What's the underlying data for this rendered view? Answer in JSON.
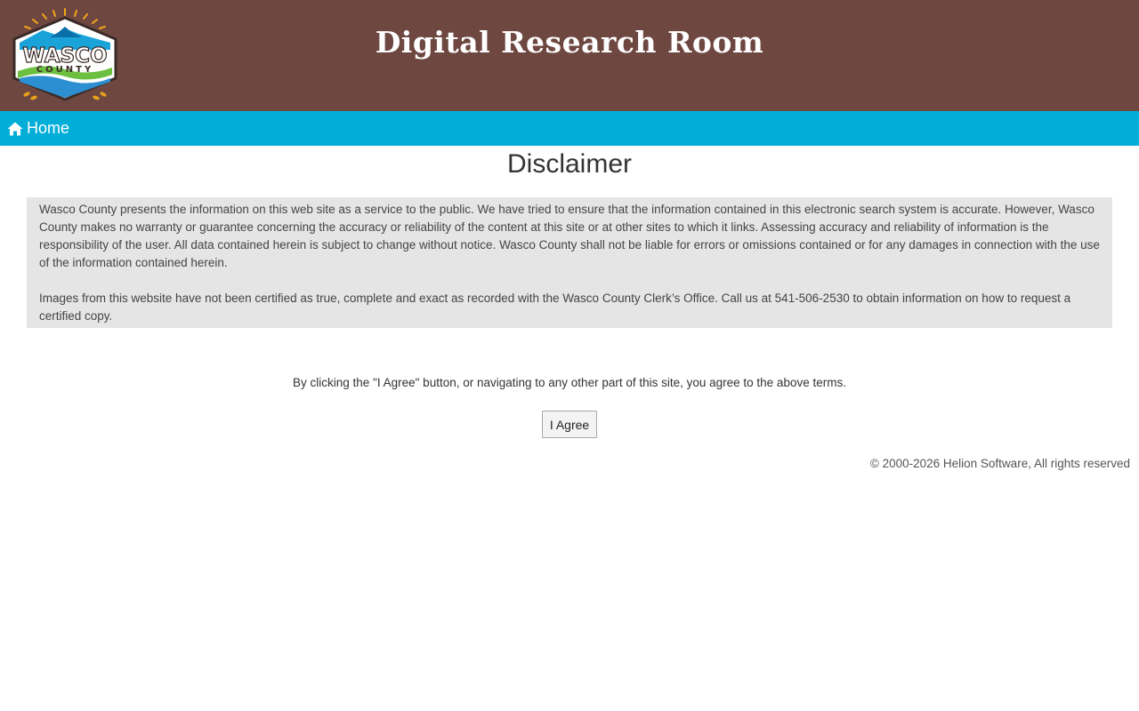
{
  "header": {
    "logo": {
      "line1": "WASCO",
      "line2": "COUNTY"
    },
    "title": "Digital Research Room"
  },
  "nav": {
    "home_icon": "home-icon",
    "home_label": "Home"
  },
  "main": {
    "heading": "Disclaimer",
    "paragraphs": [
      "Wasco County presents the information on this web site as a service to the public. We have tried to ensure that the information contained in this electronic search system is accurate. However, Wasco County makes no warranty or guarantee concerning the accuracy or reliability of the content at this site or at other sites to which it links. Assessing accuracy and reliability of information is the responsibility of the user. All data contained herein is subject to change without notice. Wasco County shall not be liable for errors or omissions contained or for any damages in connection with the use of the information contained herein.",
      "Images from this website have not been certified as true, complete and exact as recorded with the Wasco County Clerk’s Office. Call us at 541-506-2530 to obtain information on how to request a certified copy."
    ],
    "agree_note": "By clicking the \"I Agree\" button, or navigating to any other part of this site, you agree to the above terms.",
    "agree_button": "I Agree"
  },
  "footer": {
    "copyright": "© 2000-2026 Helion Software, All rights reserved"
  },
  "colors": {
    "header_bg": "#6e4741",
    "nav_bg": "#00aed8",
    "disclaimer_bg": "#e5e5e5"
  }
}
